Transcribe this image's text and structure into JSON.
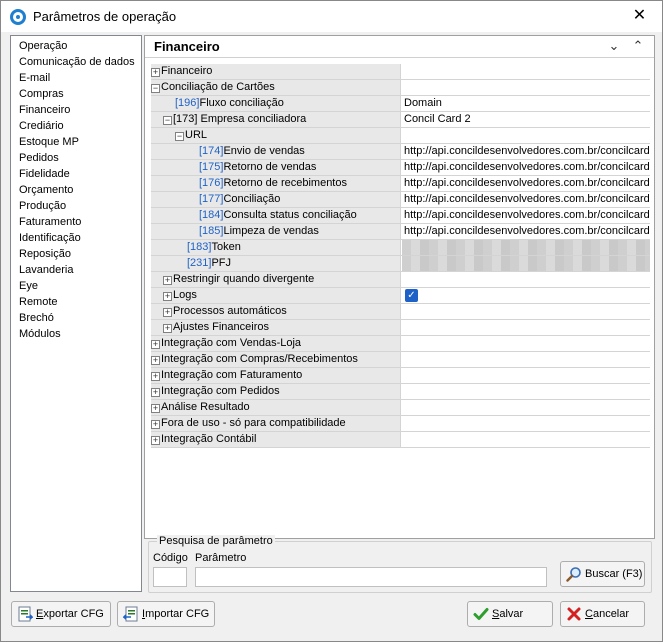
{
  "window": {
    "title": "Parâmetros de operação",
    "close": "✕"
  },
  "sidebar": {
    "items": [
      "Operação",
      "Comunicação de dados",
      "E-mail",
      "Compras",
      "Financeiro",
      "Crediário",
      "Estoque MP",
      "Pedidos",
      "Fidelidade",
      "Orçamento",
      "Produção",
      "Faturamento",
      "Identificação",
      "Reposição",
      "Lavanderia",
      "Eye",
      "Remote",
      "Brechó",
      "Módulos"
    ]
  },
  "panel": {
    "title": "Financeiro",
    "collapse_icon": "⌄",
    "expand_icon": "⌃"
  },
  "tree": {
    "rows": [
      {
        "code": "",
        "label": "Financeiro",
        "value": ""
      },
      {
        "code": "",
        "label": "Conciliação de Cartões",
        "value": ""
      },
      {
        "code": "[196]",
        "label": "Fluxo conciliação",
        "value": "Domain"
      },
      {
        "code": "[173]",
        "label": "Empresa conciliadora",
        "value": "Concil Card 2"
      },
      {
        "code": "",
        "label": "URL",
        "value": ""
      },
      {
        "code": "[174]",
        "label": "Envio de vendas",
        "value": "http://api.concildesenvolvedores.com.br/concilcard"
      },
      {
        "code": "[175]",
        "label": "Retorno de vendas",
        "value": "http://api.concildesenvolvedores.com.br/concilcard"
      },
      {
        "code": "[176]",
        "label": "Retorno de recebimentos",
        "value": "http://api.concildesenvolvedores.com.br/concilcard"
      },
      {
        "code": "[177]",
        "label": "Conciliação",
        "value": "http://api.concildesenvolvedores.com.br/concilcard"
      },
      {
        "code": "[184]",
        "label": "Consulta status conciliação",
        "value": "http://api.concildesenvolvedores.com.br/concilcard"
      },
      {
        "code": "[185]",
        "label": "Limpeza de vendas",
        "value": "http://api.concildesenvolvedores.com.br/concilcard"
      },
      {
        "code": "[183]",
        "label": "Token",
        "value": ""
      },
      {
        "code": "[231]",
        "label": "PFJ",
        "value": ""
      },
      {
        "code": "",
        "label": "Restringir quando divergente",
        "value": ""
      },
      {
        "code": "",
        "label": "Logs",
        "value": ""
      },
      {
        "code": "",
        "label": "Processos automáticos",
        "value": ""
      },
      {
        "code": "",
        "label": "Ajustes Financeiros",
        "value": ""
      },
      {
        "code": "",
        "label": "Integração com Vendas-Loja",
        "value": ""
      },
      {
        "code": "",
        "label": "Integração com Compras/Recebimentos",
        "value": ""
      },
      {
        "code": "",
        "label": "Integração com Faturamento",
        "value": ""
      },
      {
        "code": "",
        "label": "Integração com Pedidos",
        "value": ""
      },
      {
        "code": "",
        "label": "Análise Resultado",
        "value": ""
      },
      {
        "code": "",
        "label": "Fora de uso - só para compatibilidade",
        "value": ""
      },
      {
        "code": "",
        "label": "Integração Contábil",
        "value": ""
      }
    ],
    "logs_checked": true
  },
  "search": {
    "legend": "Pesquisa de parâmetro",
    "codigo_label": "Código",
    "parametro_label": "Parâmetro",
    "buscar_label": "Buscar (F3)",
    "codigo_value": "",
    "parametro_value": ""
  },
  "footer": {
    "exportar_prefix": "E",
    "exportar_rest": "xportar CFG",
    "importar_prefix": "I",
    "importar_rest": "mportar CFG",
    "salvar_prefix": "S",
    "salvar_rest": "alvar",
    "cancelar_prefix": "C",
    "cancelar_rest": "ancelar"
  },
  "colors": {
    "code_blue": "#1e62c8",
    "accent": "#1e7fd0"
  }
}
